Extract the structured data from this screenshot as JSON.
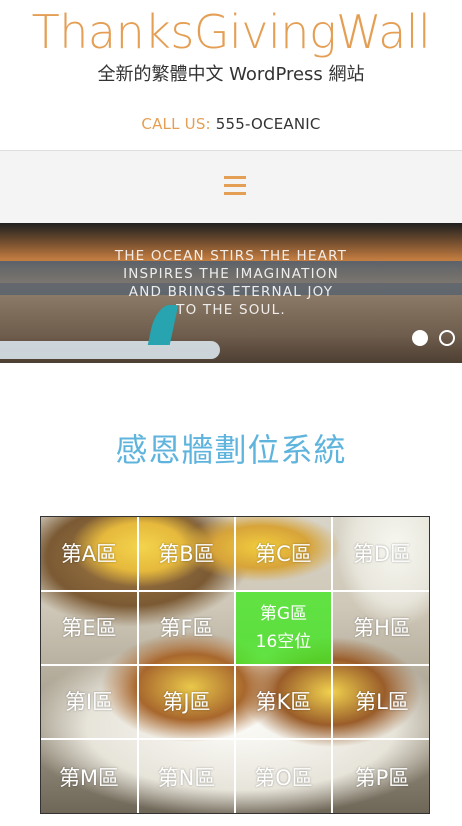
{
  "header": {
    "site_title": "ThanksGivingWall",
    "tagline": "全新的繁體中文 WordPress 網站",
    "call_label": "CALL US:",
    "call_number": "555-OCEANIC"
  },
  "nav": {
    "menu_icon": "hamburger-menu-icon"
  },
  "hero": {
    "lines": [
      "THE OCEAN STIRS THE HEART",
      "INSPIRES THE IMAGINATION",
      "AND BRINGS ETERNAL JOY",
      "TO THE SOUL."
    ],
    "slides_total": 2,
    "active_slide": 1
  },
  "main": {
    "title": "感恩牆劃位系統",
    "zones": [
      "第A區",
      "第B區",
      "第C區",
      "第D區",
      "第E區",
      "第F區",
      "第G區",
      "第H區",
      "第I區",
      "第J區",
      "第K區",
      "第L區",
      "第M區",
      "第N區",
      "第O區",
      "第P區"
    ],
    "highlight_zone": {
      "label": "第G區",
      "detail": "16空位"
    },
    "colors": {
      "highlight": "#48e628",
      "title": "#5fb4dd",
      "accent": "#e49f55"
    }
  }
}
